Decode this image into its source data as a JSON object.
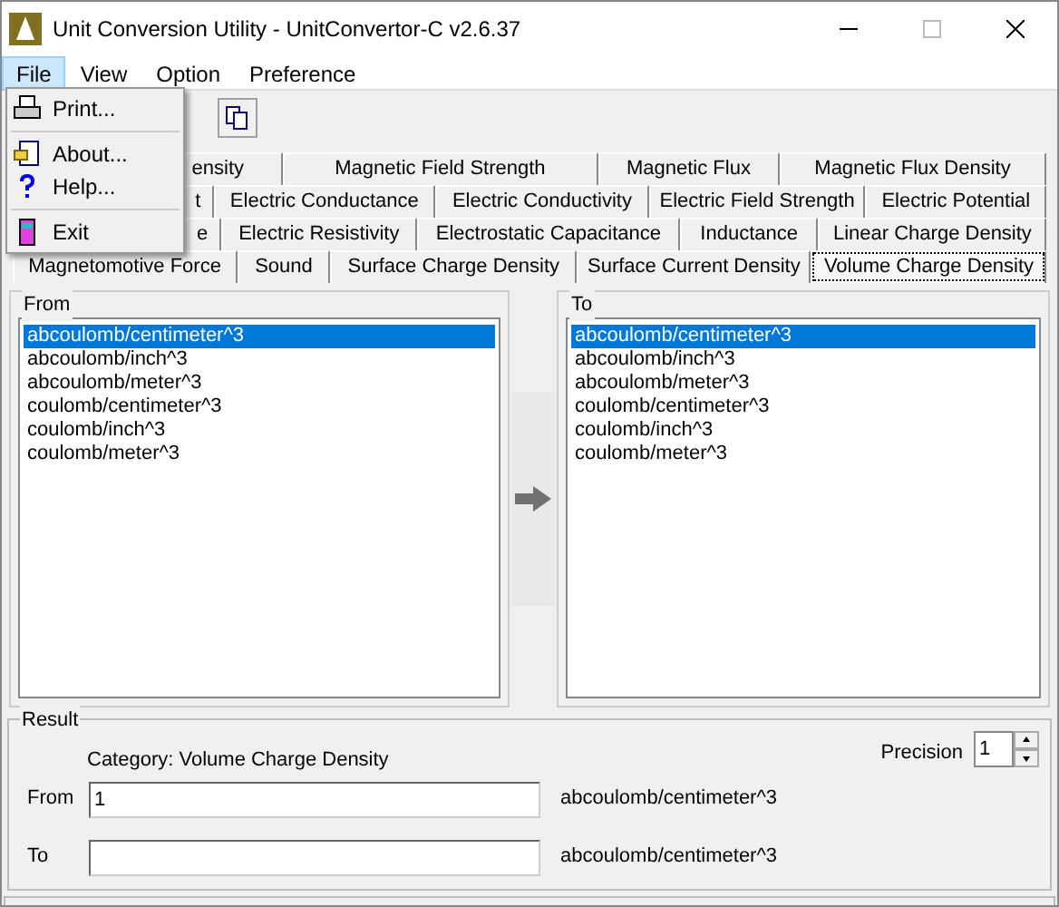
{
  "window": {
    "title": "Unit Conversion Utility - UnitConvertor-C v2.6.37"
  },
  "menu_bar": [
    {
      "label": "File",
      "selected": true
    },
    {
      "label": "View",
      "selected": false
    },
    {
      "label": "Option",
      "selected": false
    },
    {
      "label": "Preference",
      "selected": false
    }
  ],
  "file_menu": [
    {
      "kind": "print",
      "label": "Print..."
    },
    {
      "kind": "separator"
    },
    {
      "kind": "about",
      "label": "About..."
    },
    {
      "kind": "help",
      "label": "Help..."
    },
    {
      "kind": "separator"
    },
    {
      "kind": "exit",
      "label": "Exit"
    }
  ],
  "tab_rows": [
    [
      {
        "label": "ensity",
        "selected": false
      },
      {
        "label": "Magnetic Field Strength",
        "selected": false
      },
      {
        "label": "Magnetic Flux",
        "selected": false
      },
      {
        "label": "Magnetic Flux Density",
        "selected": false
      }
    ],
    [
      {
        "label": "t",
        "selected": false
      },
      {
        "label": "Electric Conductance",
        "selected": false
      },
      {
        "label": "Electric Conductivity",
        "selected": false
      },
      {
        "label": "Electric Field Strength",
        "selected": false
      },
      {
        "label": "Electric Potential",
        "selected": false
      }
    ],
    [
      {
        "label": "e",
        "selected": false
      },
      {
        "label": "Electric Resistivity",
        "selected": false
      },
      {
        "label": "Electrostatic Capacitance",
        "selected": false
      },
      {
        "label": "Inductance",
        "selected": false
      },
      {
        "label": "Linear Charge Density",
        "selected": false
      }
    ],
    [
      {
        "label": "Magnetomotive Force",
        "selected": false
      },
      {
        "label": "Sound",
        "selected": false
      },
      {
        "label": "Surface Charge Density",
        "selected": false
      },
      {
        "label": "Surface Current Density",
        "selected": false
      },
      {
        "label": "Volume Charge Density",
        "selected": true
      }
    ]
  ],
  "from": {
    "legend": "From",
    "units": [
      {
        "label": "abcoulomb/centimeter^3",
        "selected": true
      },
      {
        "label": "abcoulomb/inch^3",
        "selected": false
      },
      {
        "label": "abcoulomb/meter^3",
        "selected": false
      },
      {
        "label": "coulomb/centimeter^3",
        "selected": false
      },
      {
        "label": "coulomb/inch^3",
        "selected": false
      },
      {
        "label": "coulomb/meter^3",
        "selected": false
      }
    ]
  },
  "to": {
    "legend": "To",
    "units": [
      {
        "label": "abcoulomb/centimeter^3",
        "selected": true
      },
      {
        "label": "abcoulomb/inch^3",
        "selected": false
      },
      {
        "label": "abcoulomb/meter^3",
        "selected": false
      },
      {
        "label": "coulomb/centimeter^3",
        "selected": false
      },
      {
        "label": "coulomb/inch^3",
        "selected": false
      },
      {
        "label": "coulomb/meter^3",
        "selected": false
      }
    ]
  },
  "result": {
    "legend": "Result",
    "category": "Category: Volume Charge Density",
    "precision_label": "Precision",
    "precision": "1",
    "from_label": "From",
    "from_value": "1",
    "from_unit": "abcoulomb/centimeter^3",
    "to_label": "To",
    "to_unit": "abcoulomb/centimeter^3"
  }
}
